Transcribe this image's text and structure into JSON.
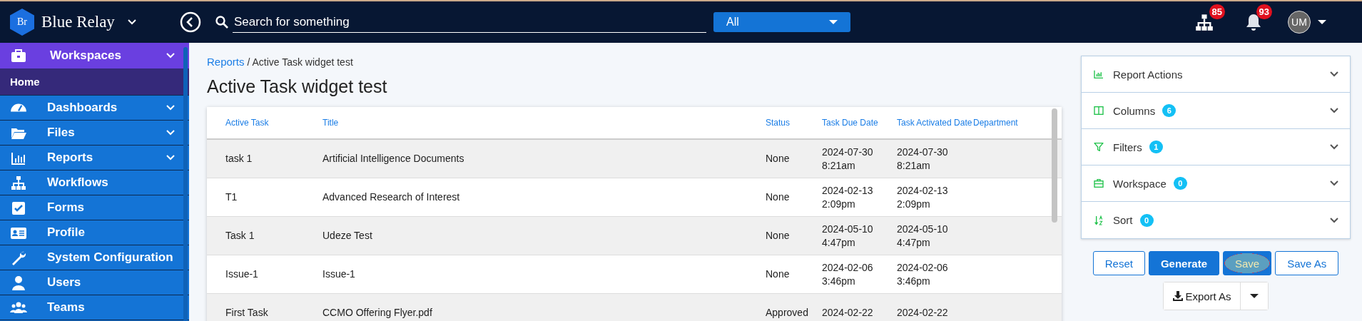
{
  "topbar": {
    "logo_text": "Br",
    "app_name": "Blue Relay",
    "search": {
      "placeholder": "Search for something"
    },
    "scope": {
      "value": "All"
    },
    "org_badge": "85",
    "notification_badge": "93",
    "avatar": "UM"
  },
  "sidebar": {
    "items": [
      {
        "label": "Workspaces",
        "selected": true,
        "has_chevron": true,
        "children": [
          {
            "label": "Home"
          }
        ]
      },
      {
        "label": "Dashboards",
        "selected": false,
        "has_chevron": true
      },
      {
        "label": "Files",
        "selected": false,
        "has_chevron": true
      },
      {
        "label": "Reports",
        "selected": false,
        "has_chevron": true
      },
      {
        "label": "Workflows",
        "selected": false,
        "has_chevron": false
      },
      {
        "label": "Forms",
        "selected": false,
        "has_chevron": false
      },
      {
        "label": "Profile",
        "selected": false,
        "has_chevron": false
      },
      {
        "label": "System Configuration",
        "selected": false,
        "has_chevron": false
      },
      {
        "label": "Users",
        "selected": false,
        "has_chevron": false
      },
      {
        "label": "Teams",
        "selected": false,
        "has_chevron": false
      }
    ]
  },
  "breadcrumb": {
    "link": "Reports",
    "separator": "/",
    "current": "Active Task widget test"
  },
  "title": "Active Task widget test",
  "table": {
    "columns": [
      "Active Task",
      "Title",
      "Status",
      "Task Due Date",
      "Task Activated Date",
      "Department"
    ],
    "rows": [
      [
        "task 1",
        "Artificial Intelligence Documents",
        "None",
        "2024-07-30\n8:21am",
        "2024-07-30\n8:21am",
        ""
      ],
      [
        "T1",
        "Advanced Research of Interest",
        "None",
        "2024-02-13\n2:09pm",
        "2024-02-13\n2:09pm",
        ""
      ],
      [
        "Task 1",
        "Udeze Test",
        "None",
        "2024-05-10\n4:47pm",
        "2024-05-10\n4:47pm",
        ""
      ],
      [
        "Issue-1",
        "Issue-1",
        "None",
        "2024-02-06\n3:46pm",
        "2024-02-06\n3:46pm",
        ""
      ],
      [
        "First Task",
        "CCMO Offering Flyer.pdf",
        "Approved",
        "2024-02-22",
        "2024-02-22",
        ""
      ]
    ]
  },
  "panel": {
    "sections": [
      {
        "label": "Report Actions"
      },
      {
        "label": "Columns",
        "count": "6"
      },
      {
        "label": "Filters",
        "count": "1"
      },
      {
        "label": "Workspace",
        "count": "0"
      },
      {
        "label": "Sort",
        "count": "0"
      }
    ]
  },
  "buttons": [
    {
      "label": "Reset",
      "kind": "outline",
      "focused": false
    },
    {
      "label": "Generate",
      "kind": "primary",
      "focused": false
    },
    {
      "label": "Save",
      "kind": "primary",
      "focused": true
    },
    {
      "label": "Save As",
      "kind": "outline",
      "focused": false
    }
  ],
  "export": {
    "label": "Export As"
  }
}
